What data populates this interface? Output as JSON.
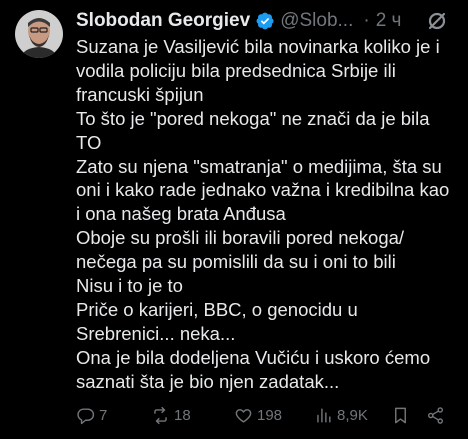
{
  "post": {
    "author_name": "Slobodan Georgiev",
    "handle": "@Slob...",
    "dot": "·",
    "time": "2 ч",
    "lines": [
      "Suzana je Vasiljević bila novinarka koliko je i",
      "vodila policiju bila predsednica Srbije ili",
      "francuski špijun",
      "To što je \"pored nekoga\" ne znači da je  bila",
      "TO",
      "Zato su njena \"smatranja\" o medijima, šta su",
      "oni i kako rade jednako važna i kredibilna kao",
      "i ona našeg brata Anđusa",
      "Oboje su prošli ili boravili pored nekoga/",
      "nečega pa su pomislili da su i oni to bili",
      "Nisu i to je to",
      "Priče o karijeri, BBC, o genocidu u",
      "Srebrenici... neka...",
      "Ona je bila dodeljena Vučiću i uskoro ćemo",
      "saznati šta je bio njen zadatak..."
    ]
  },
  "actions": {
    "replies": "7",
    "reposts": "18",
    "likes": "198",
    "views": "8,9K"
  },
  "icons": {
    "verified": "verified-badge-icon",
    "more": "grok-slash-icon",
    "reply": "reply-icon",
    "repost": "repost-icon",
    "like": "heart-icon",
    "views": "views-bar-icon",
    "bookmark": "bookmark-icon",
    "share": "share-icon"
  },
  "colors": {
    "background": "#000000",
    "text": "#e7e9ea",
    "muted": "#71767b",
    "verified": "#1d9bf0"
  }
}
